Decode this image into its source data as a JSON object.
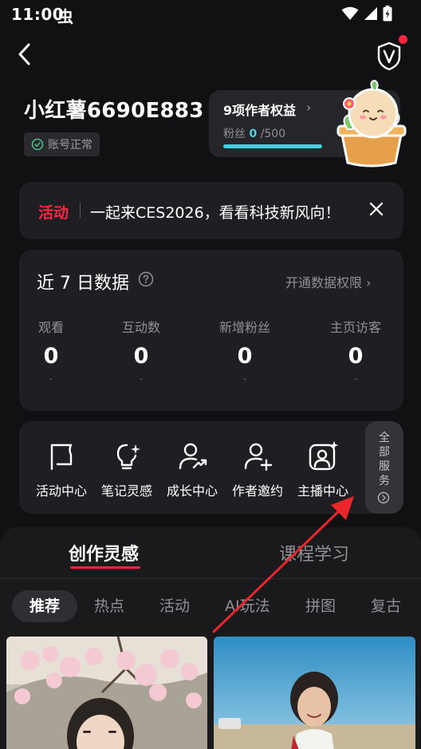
{
  "status_bar": {
    "time": "11:00",
    "notification_glyph": "虫",
    "icons": [
      "wifi-icon",
      "cellular-icon",
      "battery-icon"
    ]
  },
  "header": {
    "back_icon": "chevron-left-icon",
    "shield_icon": "shield-v-icon"
  },
  "profile": {
    "username": "小红薯6690E883",
    "account_status": "账号正常"
  },
  "rights": {
    "title": "9项作者权益",
    "arrow": "›",
    "fans_label": "粉丝",
    "fans_current": "0",
    "fans_target": "/500"
  },
  "activity": {
    "tag": "活动",
    "text": "一起来CES2026，看看科技新风向！"
  },
  "data_panel": {
    "title": "近 7 日数据",
    "open_link": "开通数据权限 ›",
    "stats": [
      {
        "label": "观看",
        "value": "0",
        "sub": "-"
      },
      {
        "label": "互动数",
        "value": "0",
        "sub": "-"
      },
      {
        "label": "新增粉丝",
        "value": "0",
        "sub": "-"
      },
      {
        "label": "主页访客",
        "value": "0",
        "sub": "-"
      }
    ]
  },
  "services": {
    "items": [
      {
        "label": "活动中心",
        "icon": "flag-icon"
      },
      {
        "label": "笔记灵感",
        "icon": "bulb-sparkle-icon"
      },
      {
        "label": "成长中心",
        "icon": "user-growth-icon"
      },
      {
        "label": "作者邀约",
        "icon": "user-add-icon"
      },
      {
        "label": "主播中心",
        "icon": "camera-user-icon"
      }
    ],
    "all_label": "全部服务"
  },
  "lower_tabs": {
    "active": "创作灵感",
    "inactive": "课程学习"
  },
  "chips": [
    "推荐",
    "热点",
    "活动",
    "AI玩法",
    "拼图",
    "复古"
  ],
  "colors": {
    "accent_red": "#ff2442",
    "accent_cyan": "#3ed3e2",
    "background": "#111113",
    "card": "#1f1f23"
  }
}
